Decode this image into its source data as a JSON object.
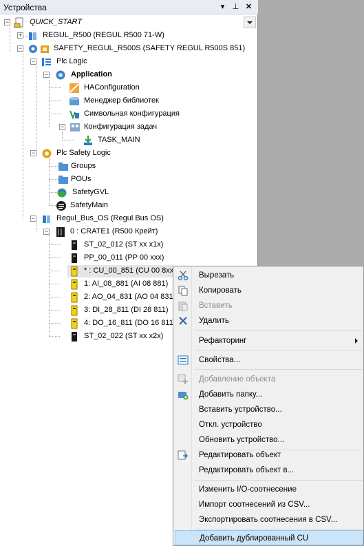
{
  "panel": {
    "title": "Устройства",
    "pin_glyph": "▾",
    "dock_glyph": "⊥",
    "close_glyph": "✕",
    "project_combo": "QUICK_START"
  },
  "tree": {
    "regul_r500": "REGUL_R500 (REGUL R500 71-W)",
    "safety_regul": "SAFETY_REGUL_R500S (SAFETY REGUL R500S 851)",
    "plc_logic": "Plc Logic",
    "application": "Application",
    "ha_config": "HAConfiguration",
    "lib_manager": "Менеджер библиотек",
    "symbol_config": "Символьная конфигурация",
    "task_config": "Конфигурация задач",
    "task_main": "TASK_MAIN",
    "plc_safety_logic": "Plc Safety Logic",
    "groups": "Groups",
    "pous": "POUs",
    "safety_gvl": "SafetyGVL",
    "safety_main": "SafetyMain",
    "regul_bus_os": "Regul_Bus_OS (Regul Bus OS)",
    "crate": "0 : CRATE1 (R500 Крейт)",
    "st_02_012": "ST_02_012 (ST xx x1x)",
    "pp_00_011": "PP_00_011 (PP 00 xxx)",
    "cu_00_851": "* : CU_00_851 (CU 00 8xx",
    "ai_08_881": "1: AI_08_881 (AI 08 881)",
    "ao_04_831": "2: AO_04_831 (AO 04 831",
    "di_28_811": "3: DI_28_811 (DI 28 811)",
    "do_16_811": "4: DO_16_811 (DO 16 811",
    "st_02_022": "ST_02_022 (ST xx x2x)"
  },
  "menu": {
    "cut": "Вырезать",
    "copy": "Копировать",
    "paste": "Вставить",
    "delete": "Удалить",
    "refactoring": "Рефакторинг",
    "properties": "Свойства...",
    "add_object": "Добавление объекта",
    "add_folder": "Добавить папку...",
    "insert_device": "Вставить устройство...",
    "disable_device": "Откл. устройство",
    "update_device": "Обновить устройство...",
    "edit_object": "Редактировать объект",
    "edit_object_with": "Редактировать объект в...",
    "change_io_mapping": "Изменить I/O-соотнесение",
    "import_mappings": "Импорт соотнесений из CSV...",
    "export_mappings": "Экспортировать соотнесения в CSV...",
    "add_duplicated_cu": "Добавить дублированный CU"
  },
  "colors": {
    "accent_blue": "#2e7ad1",
    "yellow_module": "#f2d40f",
    "highlight": "#cce4f7",
    "gear_blue": "#3b82c8",
    "gear_gold": "#e0a21c"
  }
}
